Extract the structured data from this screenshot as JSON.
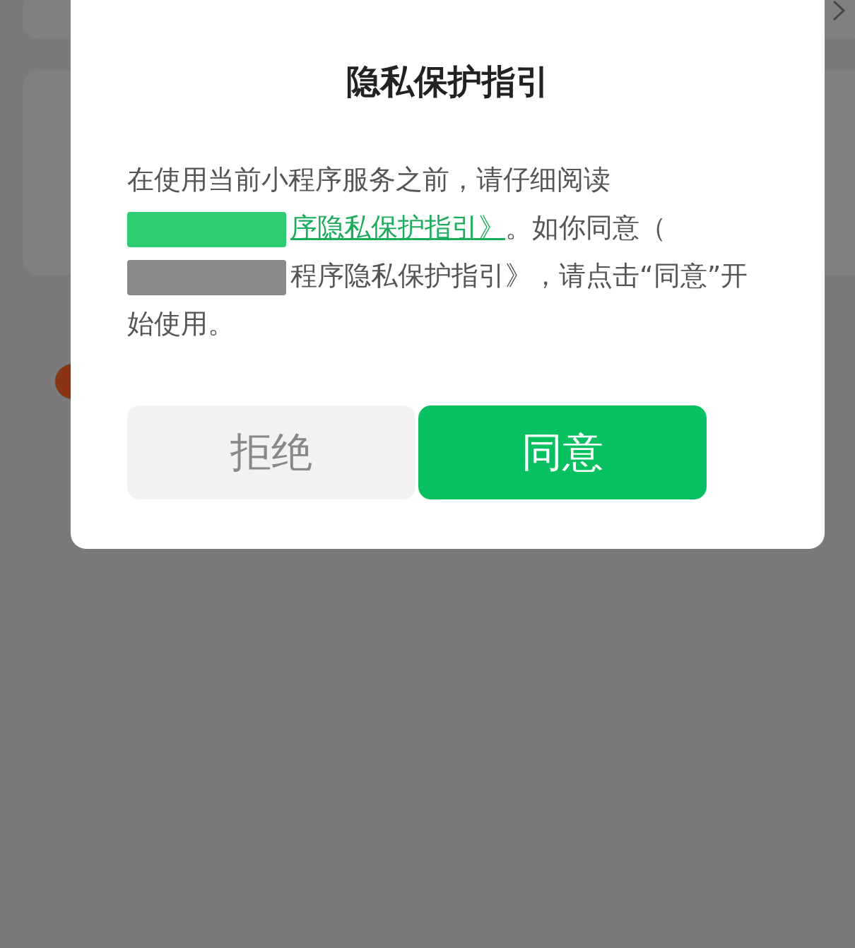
{
  "dialog": {
    "title": "隐私保护指引",
    "body": [
      {
        "kind": "text",
        "text": "在使用当前小程序服务之前，请仔细阅读"
      },
      {
        "kind": "redacted",
        "color": "#2ecc71"
      },
      {
        "kind": "link",
        "text": "序隐私保护指引》"
      },
      {
        "kind": "text",
        "text": "。如你同意（"
      },
      {
        "kind": "redacted",
        "color": "#8a8a8a"
      },
      {
        "kind": "text",
        "text": "程序隐私保护指引》，请点击“同意”开始使用。"
      }
    ],
    "buttons": [
      {
        "kind": "secondary",
        "label": "拒绝"
      },
      {
        "kind": "primary",
        "label": "同意"
      }
    ]
  }
}
